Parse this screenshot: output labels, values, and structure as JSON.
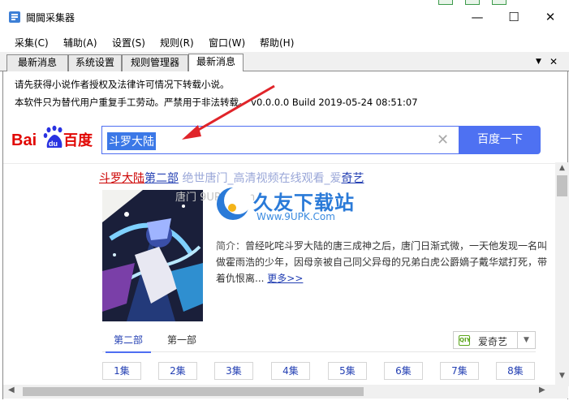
{
  "window": {
    "title": "閫閫采集器",
    "minimize_glyph": "—",
    "maximize_glyph": "☐",
    "close_glyph": "✕"
  },
  "menu": [
    {
      "label": "采集(C)"
    },
    {
      "label": "辅助(A)"
    },
    {
      "label": "设置(S)"
    },
    {
      "label": "规则(R)"
    },
    {
      "label": "窗口(W)"
    },
    {
      "label": "帮助(H)"
    }
  ],
  "tabs": [
    {
      "label": "最新消息",
      "active": false
    },
    {
      "label": "系统设置",
      "active": false
    },
    {
      "label": "规则管理器",
      "active": false
    },
    {
      "label": "最新消息",
      "active": true
    }
  ],
  "tab_controls": {
    "dropdown_glyph": "▼",
    "close_glyph": "✕"
  },
  "notice": {
    "line1": "请先获得小说作者授权及法律许可情况下转载小说。",
    "line2": "本软件只为替代用户重复手工劳动。严禁用于非法转载。 v0.0.0.0 Build 2019-05-24 08:51:07"
  },
  "search": {
    "logo_bai": "Bai",
    "logo_du": "du",
    "logo_cn": "百度",
    "query": "斗罗大陆",
    "clear_glyph": "✕",
    "button_label": "百度一下"
  },
  "result": {
    "title_em": "斗罗大陆",
    "title_rest": "第二部",
    "title_faded": " 绝世唐门_高清视频在线观看_爱",
    "title_tail": "奇艺",
    "watermark_name": "久友下载站",
    "watermark_url": "Www.9UPK.Com",
    "ghost_text": "唐门 9UPK.Com",
    "desc_label": "简介：",
    "desc_text": "曾经叱咤斗罗大陆的唐三成神之后，唐门日渐式微，一天他发现一名叫做霍雨浩的少年，因母亲被自己同父异母的兄弟白虎公爵嫡子戴华斌打死，带着仇恨离...",
    "more_link": "更多>>"
  },
  "episode_tabs": [
    {
      "label": "第二部",
      "active": true
    },
    {
      "label": "第一部",
      "active": false
    }
  ],
  "source": {
    "icon_text": "QIY",
    "label": "爱奇艺",
    "caret": "▼"
  },
  "episodes": [
    "1集",
    "2集",
    "3集",
    "4集",
    "5集",
    "6集",
    "7集",
    "8集"
  ],
  "scroll": {
    "up": "▲",
    "down": "▼",
    "left": "◀",
    "right": "▶"
  },
  "colors": {
    "baidu_blue": "#2932e1",
    "baidu_red": "#e10602",
    "search_border": "#4e6ef2",
    "search_button": "#4e71f2",
    "link": "#2440b3",
    "highlight": "#cc0000",
    "arrow": "#e0242a",
    "watermark": "#2a7ad8"
  }
}
